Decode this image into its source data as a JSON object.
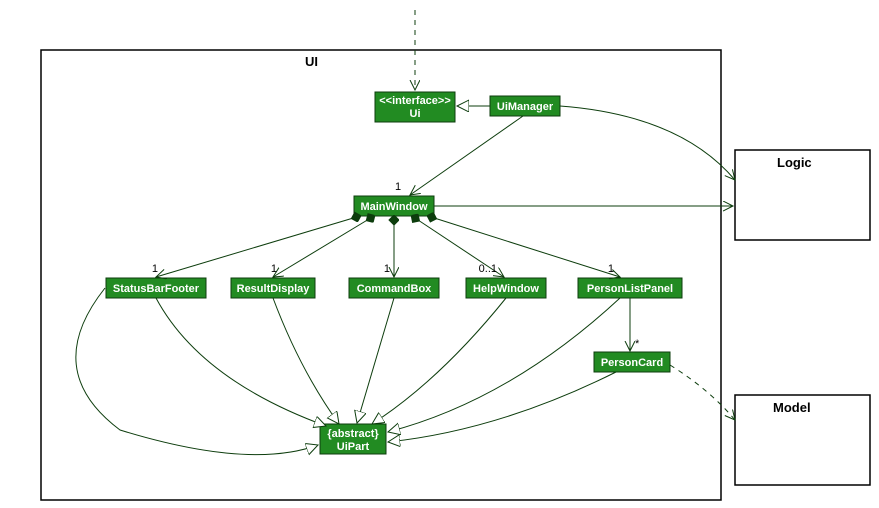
{
  "package": {
    "ui_label": "UI",
    "logic_label": "Logic",
    "model_label": "Model"
  },
  "classes": {
    "ui_interface": {
      "stereotype": "<<interface>>",
      "name": "Ui"
    },
    "ui_manager": "UiManager",
    "main_window": "MainWindow",
    "status_bar_footer": "StatusBarFooter",
    "result_display": "ResultDisplay",
    "command_box": "CommandBox",
    "help_window": "HelpWindow",
    "person_list_panel": "PersonListPanel",
    "person_card": "PersonCard",
    "ui_part": {
      "stereotype": "{abstract}",
      "name": "UiPart"
    }
  },
  "mult": {
    "mw_to_ui_manager": "1",
    "sbf": "1",
    "rd": "1",
    "cb": "1",
    "hw": "0..1",
    "plp": "1",
    "pc": "*"
  }
}
